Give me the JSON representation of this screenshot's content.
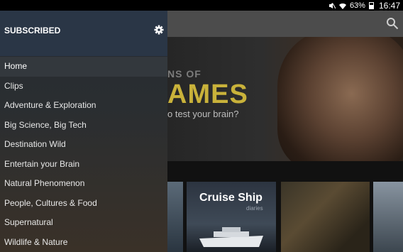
{
  "status_bar": {
    "battery": "63%",
    "time": "16:47"
  },
  "drawer": {
    "header_label": "SUBSCRIBED",
    "items": [
      {
        "label": "Home",
        "active": true
      },
      {
        "label": "Clips"
      },
      {
        "label": "Adventure & Exploration"
      },
      {
        "label": "Big Science, Big Tech"
      },
      {
        "label": "Destination Wild"
      },
      {
        "label": "Entertain your Brain"
      },
      {
        "label": "Natural Phenomenon"
      },
      {
        "label": "People, Cultures & Food"
      },
      {
        "label": "Supernatural"
      },
      {
        "label": "Wildlife & Nature"
      }
    ]
  },
  "hero": {
    "line1": "NS OF",
    "line2": "AMES",
    "line3": "o test your brain?"
  },
  "tiles": [
    {
      "title": "Cruise Ship",
      "subtitle": "diaries"
    }
  ],
  "colors": {
    "accent": "#c9b23a",
    "drawer_header": "#2a3646"
  },
  "icons": [
    "mute-icon",
    "wifi-icon",
    "battery-icon",
    "search-icon",
    "gear-icon"
  ]
}
